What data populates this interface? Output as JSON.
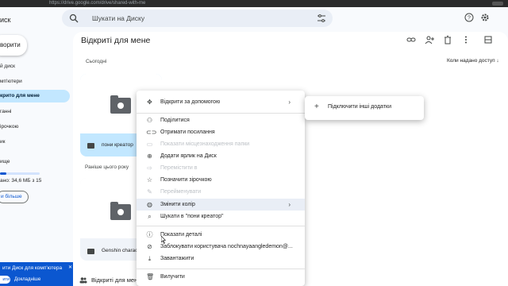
{
  "browser": {
    "url": "https://drive.google.com/drive/shared-with-me"
  },
  "app": {
    "name": "иск"
  },
  "search": {
    "placeholder": "Шукати на Диску"
  },
  "header_icons": [
    "help-icon",
    "settings-icon"
  ],
  "sidebar": {
    "new_label": "ворити",
    "items": [
      {
        "label": "й диск"
      },
      {
        "label": "мп'ютери"
      },
      {
        "label": "крито для мене",
        "active": true
      },
      {
        "label": "ганні"
      },
      {
        "label": "ірочкою"
      },
      {
        "label": "ик"
      },
      {
        "label": "ище"
      }
    ],
    "storage_text": "ано: 34,6 МБ з 15",
    "storage_fraction": 0.002,
    "more_storage": "и більше"
  },
  "promo": {
    "text": "ити Диск для комп'ютера",
    "close": "✕",
    "btn1": "ити",
    "btn2": "Докладніше"
  },
  "main": {
    "title": "Відкриті для мене",
    "toolbar_icons": [
      "link-icon",
      "add-person-icon",
      "trash-icon",
      "more-vert-icon",
      "grid-view-icon"
    ],
    "section_today": "Сьогодні",
    "section_earlier": "Раніше цього року",
    "sort_label": "Коли надано доступ ↓",
    "files": [
      {
        "name": "пони креатор"
      },
      {
        "name": "Genshin charact"
      }
    ],
    "bottom_label": "Відкриті для мене"
  },
  "context_menu": {
    "items": [
      {
        "label": "Відкрити за допомогою",
        "icon": "open-with-icon",
        "submenu": true
      },
      {
        "label": "Поділитися",
        "icon": "share-icon"
      },
      {
        "label": "Отримати посилання",
        "icon": "link-icon"
      },
      {
        "label": "Показати місцезнаходження папки",
        "icon": "folder-icon",
        "disabled": true
      },
      {
        "label": "Додати ярлик на Диск",
        "icon": "shortcut-icon"
      },
      {
        "label": "Перемістити в",
        "icon": "move-icon",
        "disabled": true
      },
      {
        "label": "Позначити зірочкою",
        "icon": "star-icon"
      },
      {
        "label": "Перейменувати",
        "icon": "edit-icon",
        "disabled": true
      },
      {
        "label": "Змінити колір",
        "icon": "palette-icon",
        "submenu": true,
        "highlighted": true
      },
      {
        "label": "Шукати в \"пони креатор\"",
        "icon": "search-icon"
      },
      {
        "label": "Показати деталі",
        "icon": "info-icon"
      },
      {
        "label": "Заблокувати користувача nochnayaangledemon@...",
        "icon": "block-icon"
      },
      {
        "label": "Завантажити",
        "icon": "download-icon"
      },
      {
        "label": "Вилучити",
        "icon": "trash-icon"
      }
    ]
  },
  "submenu": {
    "label": "Підключити інші додатки",
    "icon": "plus-icon"
  }
}
